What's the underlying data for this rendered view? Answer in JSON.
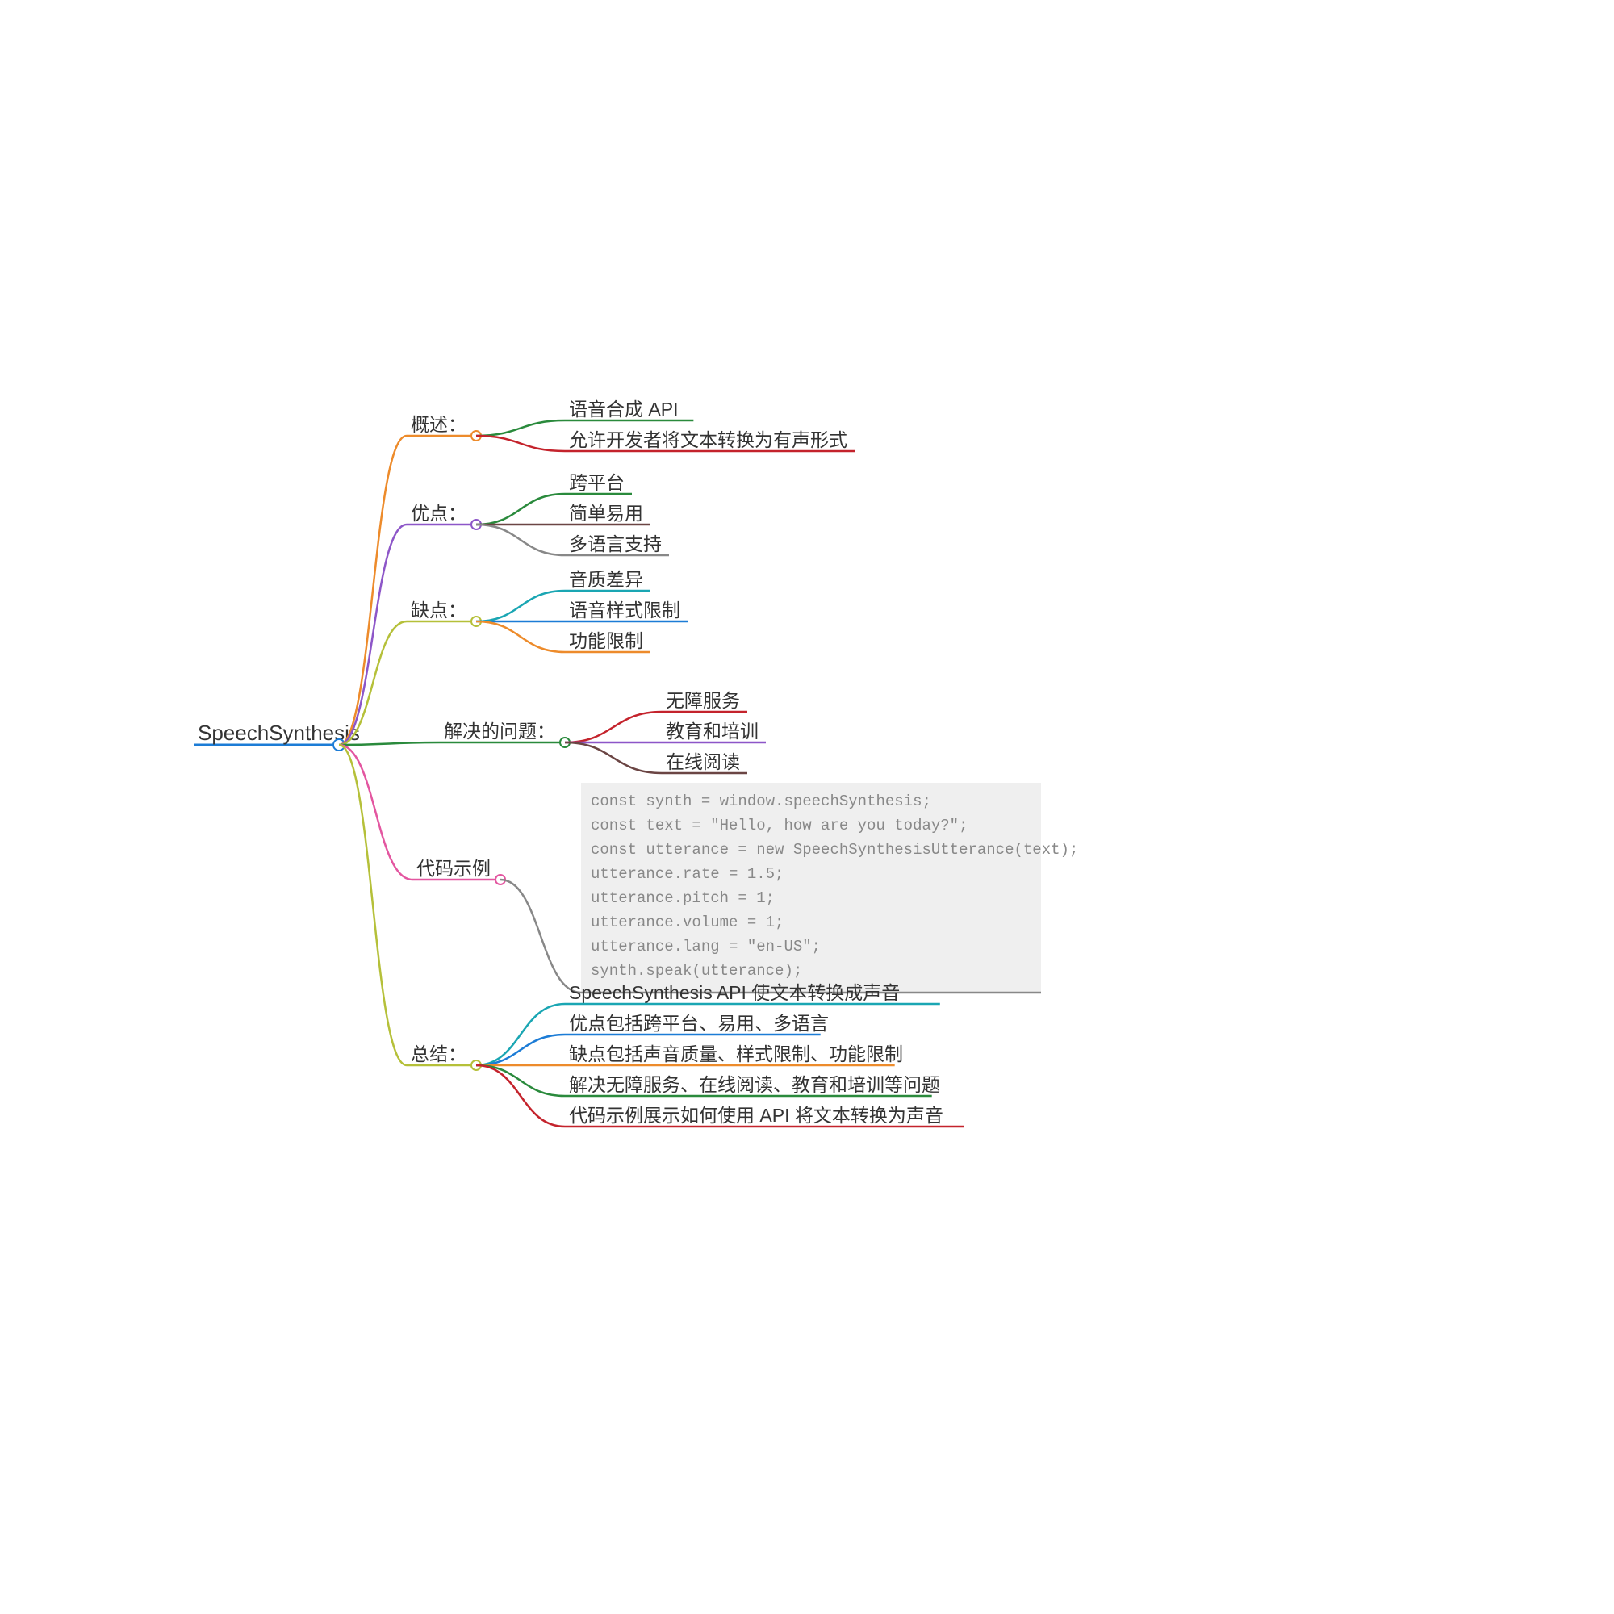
{
  "root": {
    "label": "SpeechSynthesis"
  },
  "branches": [
    {
      "label": "概述：",
      "color": "#ed8b2b",
      "children": [
        {
          "label": "语音合成 API",
          "color": "#2a8a3c"
        },
        {
          "label": "允许开发者将文本转换为有声形式",
          "color": "#c4232c"
        }
      ]
    },
    {
      "label": "优点：",
      "color": "#8d56c8",
      "children": [
        {
          "label": "跨平台",
          "color": "#2a8a3c"
        },
        {
          "label": "简单易用",
          "color": "#6b4544"
        },
        {
          "label": "多语言支持",
          "color": "#888888"
        }
      ]
    },
    {
      "label": "缺点：",
      "color": "#b5c039",
      "children": [
        {
          "label": "音质差异",
          "color": "#1aa6b3"
        },
        {
          "label": "语音样式限制",
          "color": "#1c7cd6"
        },
        {
          "label": "功能限制",
          "color": "#ed8b2b"
        }
      ]
    },
    {
      "label": "解决的问题：",
      "color": "#2a8a3c",
      "children": [
        {
          "label": "无障服务",
          "color": "#c4232c"
        },
        {
          "label": "教育和培训",
          "color": "#8d56c8"
        },
        {
          "label": "在线阅读",
          "color": "#6b4544"
        }
      ]
    },
    {
      "label": "代码示例",
      "color": "#e356a0",
      "children": [
        {
          "type": "code",
          "color": "#888888",
          "lines": [
            "const synth = window.speechSynthesis;",
            "const text = \"Hello, how are you today?\";",
            "const utterance = new SpeechSynthesisUtterance(text);",
            "utterance.rate = 1.5;",
            "utterance.pitch = 1;",
            "utterance.volume = 1;",
            "utterance.lang = \"en-US\";",
            "synth.speak(utterance);"
          ]
        }
      ]
    },
    {
      "label": "总结：",
      "color": "#b5c039",
      "children": [
        {
          "label": "SpeechSynthesis API 使文本转换成声音",
          "color": "#1aa6b3"
        },
        {
          "label": "优点包括跨平台、易用、多语言",
          "color": "#1c7cd6"
        },
        {
          "label": "缺点包括声音质量、样式限制、功能限制",
          "color": "#ed8b2b"
        },
        {
          "label": "解决无障服务、在线阅读、教育和培训等问题",
          "color": "#2a8a3c"
        },
        {
          "label": "代码示例展示如何使用 API 将文本转换为声音",
          "color": "#c4232c"
        }
      ]
    }
  ],
  "rootColor": "#1c7cd6"
}
